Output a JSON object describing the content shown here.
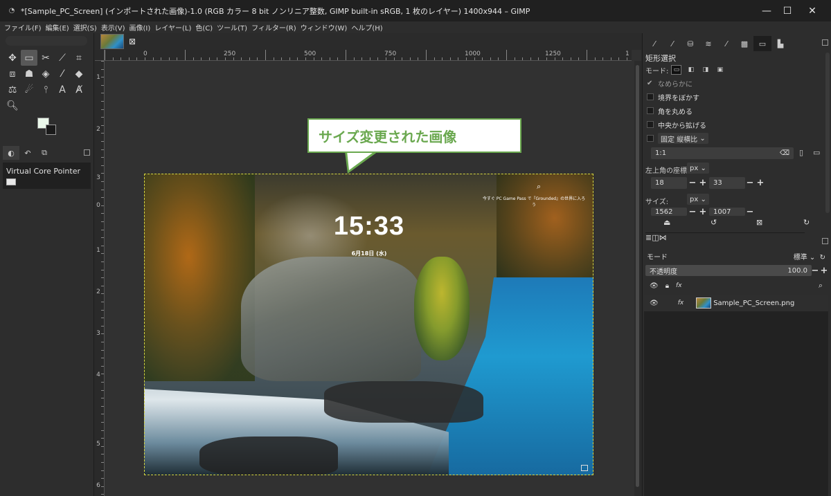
{
  "window": {
    "title": "*[Sample_PC_Screen] (インポートされた画像)-1.0 (RGB カラー 8 bit ノンリニア整数, GIMP built-in sRGB, 1 枚のレイヤー) 1400x944 – GIMP",
    "app_icon": "gimp-icon"
  },
  "menu": [
    "ファイル(F)",
    "編集(E)",
    "選択(S)",
    "表示(V)",
    "画像(I)",
    "レイヤー(L)",
    "色(C)",
    "ツール(T)",
    "フィルター(R)",
    "ウィンドウ(W)",
    "ヘルプ(H)"
  ],
  "toolbox": {
    "tools": [
      {
        "name": "move-tool-icon",
        "glyph": "✥"
      },
      {
        "name": "rect-select-tool-icon",
        "glyph": "▭",
        "active": true
      },
      {
        "name": "scissors-tool-icon",
        "glyph": "✂"
      },
      {
        "name": "fuzzy-select-tool-icon",
        "glyph": "⟋"
      },
      {
        "name": "crop-tool-icon",
        "glyph": "⌗"
      },
      {
        "name": "transform-tool-icon",
        "glyph": "⧈"
      },
      {
        "name": "warp-tool-icon",
        "glyph": "☗"
      },
      {
        "name": "bucket-fill-tool-icon",
        "glyph": "◈"
      },
      {
        "name": "paintbrush-tool-icon",
        "glyph": "⁄"
      },
      {
        "name": "eraser-tool-icon",
        "glyph": "◆"
      },
      {
        "name": "clone-tool-icon",
        "glyph": "⚖"
      },
      {
        "name": "smudge-tool-icon",
        "glyph": "☄"
      },
      {
        "name": "paths-tool-icon",
        "glyph": "⫯"
      },
      {
        "name": "text-tool-icon",
        "glyph": "A"
      },
      {
        "name": "measure-tool-icon",
        "glyph": "Ⱥ"
      },
      {
        "name": "zoom-tool-icon",
        "glyph": "🔍︎"
      }
    ],
    "dock_tabs": [
      "◐",
      "↶",
      "⧉"
    ],
    "device_label": "Virtual Core Pointer"
  },
  "image_tab": {
    "close_glyph": "⊠"
  },
  "rulers": {
    "h_labels": [
      "0",
      "250",
      "500",
      "750",
      "1000",
      "1250",
      "1"
    ],
    "v_labels": [
      "1",
      "2",
      "3",
      "0",
      "1",
      "2",
      "3",
      "4",
      "5",
      "6"
    ]
  },
  "lockscreen": {
    "time": "15:33",
    "date": "6月18日 (水)",
    "news": "今すぐ PC Game Pass で『Grounded』の世界に入ろう",
    "search_glyph": "⌕"
  },
  "callout": {
    "text": "サイズ変更された画像",
    "color": "#6aa84f"
  },
  "tool_options": {
    "title": "矩形選択",
    "mode_label": "モード:",
    "antialias": "なめらかに",
    "feather": "境界をぼかす",
    "rounded": "角を丸める",
    "expand_center": "中央から拡げる",
    "fixed": "固定",
    "fixed_combo": "縦横比",
    "ratio_value": "1:1",
    "position_label": "左上角の座標:",
    "position_unit": "px",
    "pos_x": "18",
    "pos_y": "33",
    "size_label": "サイズ:",
    "size_unit": "px",
    "size_w": "1562",
    "size_h": "1007"
  },
  "layers": {
    "mode_label": "モード",
    "mode_value": "標準",
    "opacity_label": "不透明度",
    "opacity_value": "100.0",
    "layer_name": "Sample_PC_Screen.png"
  },
  "colors": {
    "fg": "#eaf8ea",
    "bg": "#1a1a1a",
    "accent": "#6aa84f"
  }
}
